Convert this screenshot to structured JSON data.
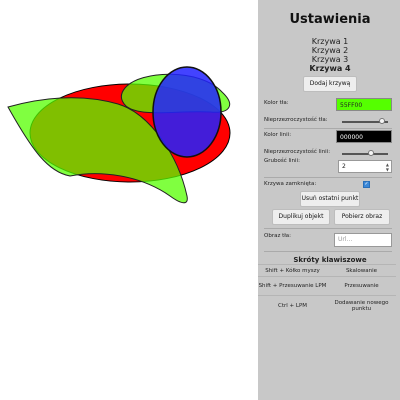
{
  "settings": {
    "title": "Ustawienia",
    "curves": [
      "Krzywa 1",
      "Krzywa 2",
      "Krzywa 3",
      "Krzywa 4"
    ],
    "active_curve": "Krzywa 4",
    "add_curve_label": "Dodaj krzywą",
    "background_color_label": "Kolor tła:",
    "background_color_value": "55FF00",
    "background_opacity_label": "Nieprzezroczystość tła:",
    "background_opacity": 0.85,
    "line_color_label": "Kolor linii:",
    "line_color_value": "000000",
    "line_opacity_label": "Nieprzezroczystość linii:",
    "line_opacity": 0.65,
    "line_width_label": "Grubość linii:",
    "line_width_value": "2",
    "closed_curve_label": "Krzywa zamknięta:",
    "closed_curve_checked": true,
    "remove_last_point_label": "Usuń ostatni punkt",
    "duplicate_object_label": "Duplikuj objekt",
    "get_image_label": "Pobierz obraz",
    "background_image_label": "Obraz tła:",
    "background_image_placeholder": "Url..."
  },
  "shortcuts": {
    "title": "Skróty klawiszowe",
    "rows": [
      {
        "keys": "Shift + Kółko myszy",
        "action": "Skalowanie"
      },
      {
        "keys": "Shift + Przesuwanie LPM",
        "action": "Przesuwanie"
      },
      {
        "keys": "Ctrl + LPM",
        "action": "Dodawanie nowego punktu"
      }
    ]
  },
  "colors": {
    "panel_bg": "#c8c8c8",
    "red": "#ff0000",
    "green": "#55ff00",
    "blue": "#2222ff",
    "swatch_bg": "#55ff00",
    "swatch_line": "#000000"
  }
}
